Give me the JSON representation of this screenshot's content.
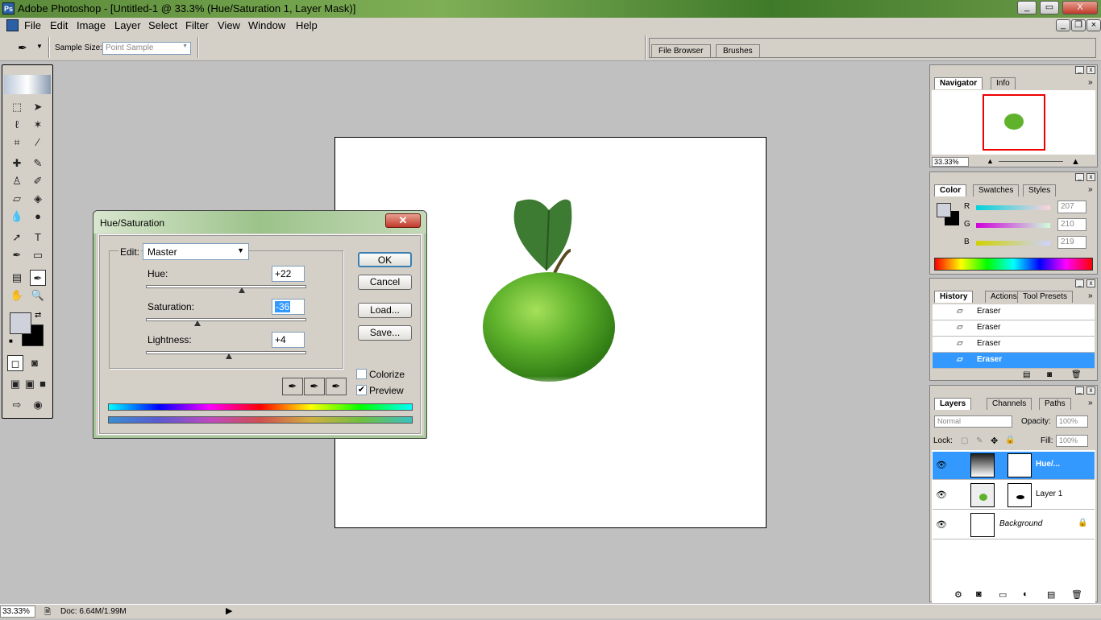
{
  "window": {
    "title": "Adobe Photoshop - [Untitled-1 @ 33.3% (Hue/Saturation 1, Layer Mask)]",
    "controls": [
      "_",
      "▭",
      "X"
    ]
  },
  "menu": [
    "File",
    "Edit",
    "Image",
    "Layer",
    "Select",
    "Filter",
    "View",
    "Window",
    "Help"
  ],
  "options": {
    "sample_label": "Sample Size:",
    "sample_value": "Point Sample"
  },
  "palette_well": {
    "tabs": [
      "File Browser",
      "Brushes"
    ]
  },
  "dialog": {
    "title": "Hue/Saturation",
    "edit_label": "Edit:",
    "edit_value": "Master",
    "hue_label": "Hue:",
    "hue_value": "+22",
    "hue_level": 0.6,
    "sat_label": "Saturation:",
    "sat_value": "-36",
    "sat_level": 0.32,
    "light_label": "Lightness:",
    "light_value": "+4",
    "light_level": 0.52,
    "ok": "OK",
    "cancel": "Cancel",
    "load": "Load...",
    "save": "Save...",
    "colorize": "Colorize",
    "colorize_checked": false,
    "preview": "Preview",
    "preview_checked": true
  },
  "navigator": {
    "tabs": [
      "Navigator",
      "Info"
    ],
    "zoom": "33.33%"
  },
  "color": {
    "tabs": [
      "Color",
      "Swatches",
      "Styles"
    ],
    "r_label": "R",
    "r": "207",
    "g_label": "G",
    "g": "210",
    "b_label": "B",
    "b": "219"
  },
  "history": {
    "tabs": [
      "History",
      "Actions",
      "Tool Presets"
    ],
    "items": [
      "Eraser",
      "Eraser",
      "Eraser",
      "Eraser"
    ]
  },
  "layers": {
    "tabs": [
      "Layers",
      "Channels",
      "Paths"
    ],
    "blend": "Normal",
    "opacity_label": "Opacity:",
    "opacity": "100%",
    "lock_label": "Lock:",
    "fill_label": "Fill:",
    "fill": "100%",
    "items": [
      "Hue/...",
      "Layer 1",
      "Background"
    ]
  },
  "status": {
    "zoom": "33.33%",
    "doc": "Doc: 6.64M/1.99M"
  },
  "colors": {
    "selection": "#3399ff",
    "accent_green": "#6fbf3a"
  }
}
